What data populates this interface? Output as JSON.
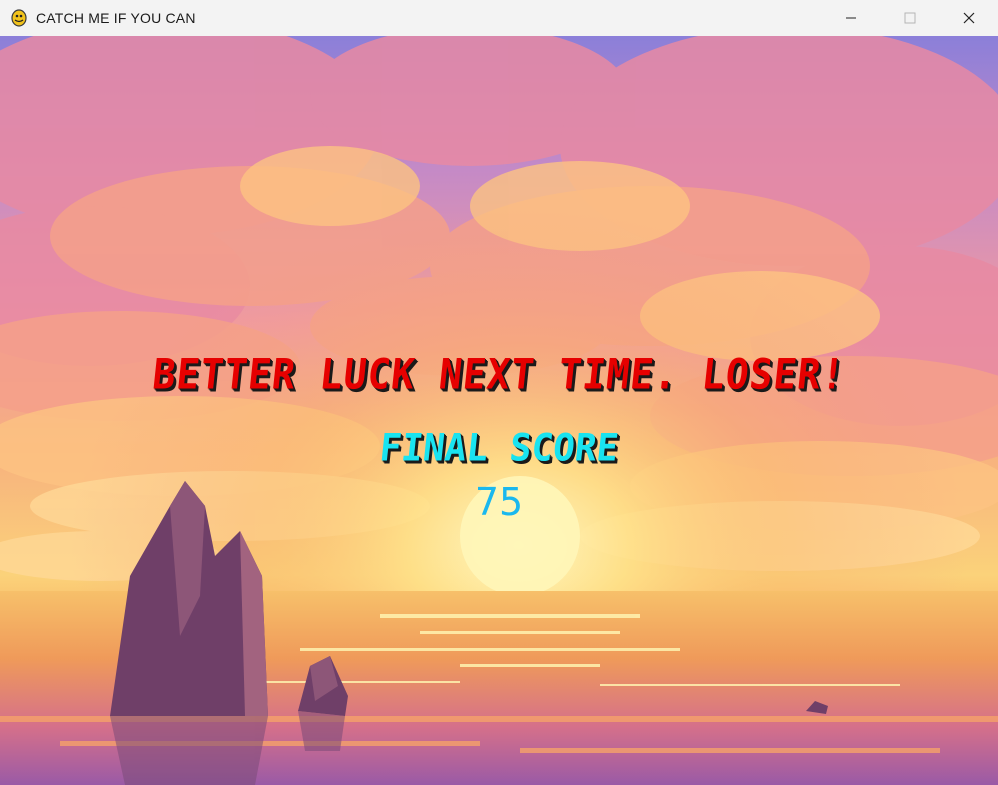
{
  "window": {
    "title": "CATCH ME IF YOU CAN",
    "icon": "python-snake-icon",
    "controls": [
      "minimize-icon",
      "maximize-icon",
      "close-icon"
    ]
  },
  "game_over": {
    "message": "BETTER LUCK NEXT TIME. LOSER!",
    "score_label": "FINAL SCORE",
    "score_value": "75"
  },
  "colors": {
    "message": "#e60000",
    "score_label": "#19e3f0",
    "score_value": "#1ab8ee",
    "sky_top": "#8a7fd6",
    "sun": "#fff6b0",
    "sea": "#e8864e"
  }
}
